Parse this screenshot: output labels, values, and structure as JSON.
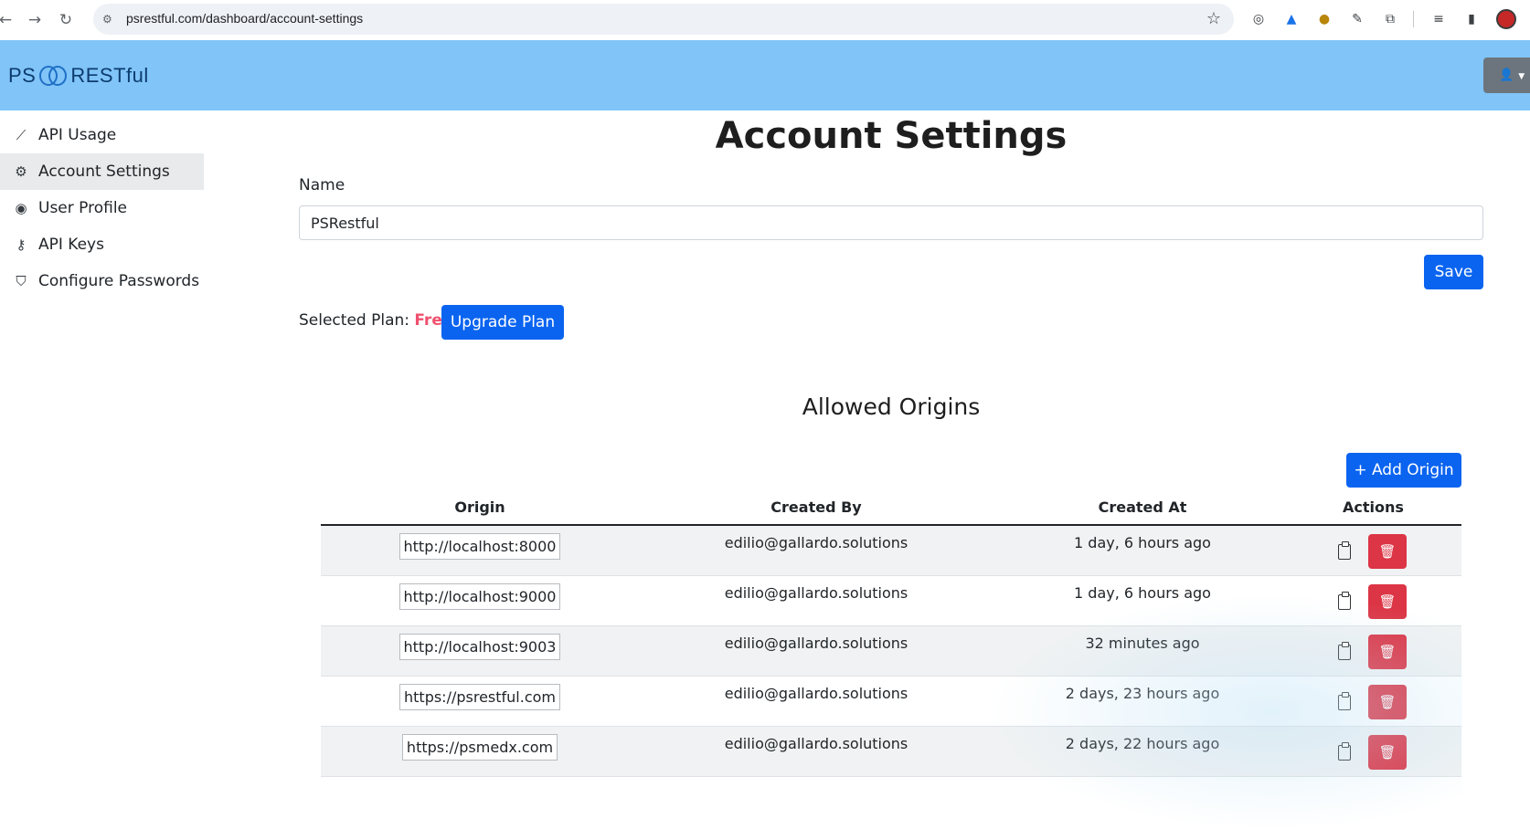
{
  "browser": {
    "url": "psrestful.com/dashboard/account-settings"
  },
  "header": {
    "logo_left": "PS",
    "logo_right": "RESTful"
  },
  "sidebar": {
    "items": [
      {
        "label": "API Usage",
        "icon": "chart-line-icon"
      },
      {
        "label": "Account Settings",
        "icon": "gear-icon",
        "active": true
      },
      {
        "label": "User Profile",
        "icon": "user-circle-icon"
      },
      {
        "label": "API Keys",
        "icon": "key-icon"
      },
      {
        "label": "Configure Passwords",
        "icon": "shield-icon"
      }
    ]
  },
  "main": {
    "title": "Account Settings",
    "name_label": "Name",
    "name_value": "PSRestful",
    "save_label": "Save",
    "plan_label": "Selected Plan:",
    "plan_value": "Free",
    "upgrade_label": "Upgrade Plan",
    "origins_title": "Allowed Origins",
    "add_origin_label": "+ Add Origin",
    "columns": [
      "Origin",
      "Created By",
      "Created At",
      "Actions"
    ],
    "rows": [
      {
        "origin": "http://localhost:8000",
        "created_by": "edilio@gallardo.solutions",
        "created_at": "1 day, 6 hours ago"
      },
      {
        "origin": "http://localhost:9000",
        "created_by": "edilio@gallardo.solutions",
        "created_at": "1 day, 6 hours ago"
      },
      {
        "origin": "http://localhost:9003",
        "created_by": "edilio@gallardo.solutions",
        "created_at": "32 minutes ago"
      },
      {
        "origin": "https://psrestful.com",
        "created_by": "edilio@gallardo.solutions",
        "created_at": "2 days, 23 hours ago"
      },
      {
        "origin": "https://psmedx.com",
        "created_by": "edilio@gallardo.solutions",
        "created_at": "2 days, 22 hours ago"
      }
    ]
  },
  "colors": {
    "header_bg": "#80c4f8",
    "primary": "#0a64f0",
    "danger": "#dc3545",
    "plan_accent": "#f0506e"
  }
}
